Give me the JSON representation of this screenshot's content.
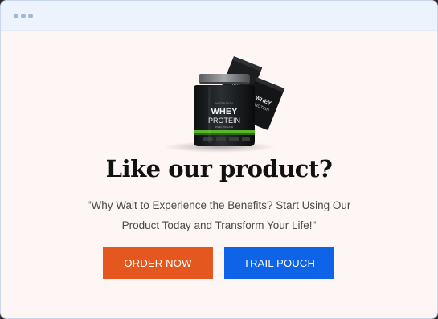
{
  "window": {
    "controls": [
      "dot",
      "dot",
      "dot"
    ]
  },
  "product": {
    "tub_brand": "WHEY",
    "tub_product": "PROTEIN",
    "pouch_label": "WHEY PROTEIN"
  },
  "popup": {
    "headline": "Like our product?",
    "subtext_line1": "\"Why Wait to Experience the Benefits?  Start Using Our",
    "subtext_line2": "Product Today and Transform Your Life!\"",
    "primary_button": "ORDER NOW",
    "secondary_button": "TRAIL POUCH"
  },
  "colors": {
    "primary_button": "#e4571e",
    "secondary_button": "#0e63e6",
    "background": "#fdf6f5",
    "titlebar": "#ecf3fd"
  }
}
